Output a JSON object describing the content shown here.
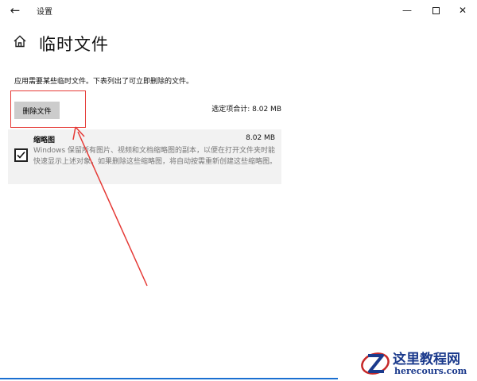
{
  "window": {
    "app_title": "设置",
    "back_glyph": "←",
    "minimize_glyph": "—",
    "close_glyph": "✕"
  },
  "page": {
    "title": "临时文件",
    "description": "应用需要某些临时文件。下表列出了可立即删除的文件。"
  },
  "toolbar": {
    "remove_button_label": "删除文件",
    "selected_total": "选定项合计: 8.02 MB"
  },
  "files": [
    {
      "name": "缩略图",
      "size": "8.02 MB",
      "checked": true,
      "description": "Windows 保留所有图片、视频和文档缩略图的副本，以便在打开文件夹时能快速显示上述对象。如果删除这些缩略图，将自动按需重新创建这些缩略图。"
    }
  ],
  "watermark": {
    "title": "这里教程网",
    "url": "herecours.com"
  },
  "colors": {
    "annotation": "#e53935",
    "button_bg": "#cccccc",
    "row_bg": "#f2f2f2",
    "watermark": "#1b3a8c"
  }
}
